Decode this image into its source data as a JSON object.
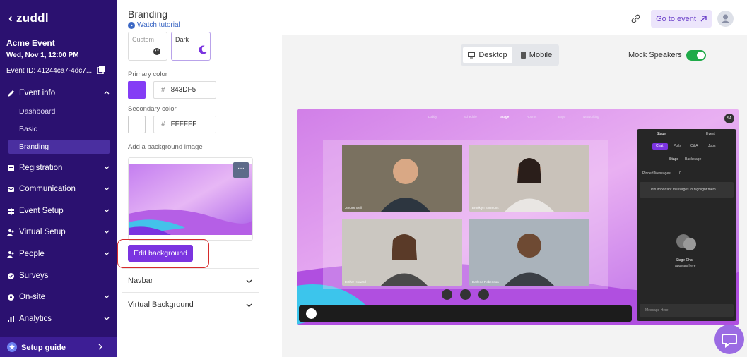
{
  "sidebar": {
    "logo": "zuddl",
    "event_name": "Acme Event",
    "event_date": "Wed, Nov 1, 12:00 PM",
    "event_id": "Event ID: 41244ca7-4dc7...",
    "nav": [
      {
        "label": "Event info"
      },
      {
        "label": "Registration"
      },
      {
        "label": "Communication"
      },
      {
        "label": "Event Setup"
      },
      {
        "label": "Virtual Setup"
      },
      {
        "label": "People"
      },
      {
        "label": "Surveys"
      },
      {
        "label": "On-site"
      },
      {
        "label": "Analytics"
      }
    ],
    "subnav": [
      "Dashboard",
      "Basic",
      "Branding"
    ],
    "setup_guide": "Setup guide"
  },
  "panel": {
    "title": "Branding",
    "watch_tutorial": "Watch tutorial",
    "themes": [
      "Custom",
      "Dark"
    ],
    "primary_color_label": "Primary color",
    "primary_color": "843DF5",
    "secondary_color_label": "Secondary color",
    "secondary_color": "FFFFFF",
    "hash": "#",
    "bg_image_label": "Add a background image",
    "more": "···",
    "edit_background": "Edit background",
    "accordions": [
      "Navbar",
      "Virtual Background"
    ]
  },
  "header": {
    "go_to_event": "Go to event"
  },
  "preview": {
    "desktop": "Desktop",
    "mobile": "Mobile",
    "mock_speakers": "Mock Speakers",
    "mock_speakers_on": true
  },
  "stage": {
    "nav": [
      "Lobby",
      "Schedule",
      "Stage",
      "Rooms",
      "Expo",
      "Networking"
    ],
    "user_initials": "SA",
    "speakers": [
      "Jerome Bell",
      "Brooklyn Simmons",
      "Esther Howard",
      "Darlene Robertson"
    ],
    "chat_tabs": [
      "Stage",
      "Event"
    ],
    "chat_subtabs": [
      "Chat",
      "Polls",
      "Q&A",
      "Jobs"
    ],
    "chat_filter": [
      "Stage",
      "Backstage"
    ],
    "pinned_label": "Pinned Messages",
    "pinned_count": "0",
    "pinned_empty": "Pin important messages to highlight them",
    "stage_chat_title": "Stage Chat",
    "stage_chat_sub": "appears here",
    "message_placeholder": "Message Here"
  },
  "colors": {
    "sidebar": "#2b1170",
    "primary": "#843DF5",
    "accent_button": "#7b34e0",
    "toggle_on": "#1faa49",
    "highlight": "#d62b2b"
  }
}
